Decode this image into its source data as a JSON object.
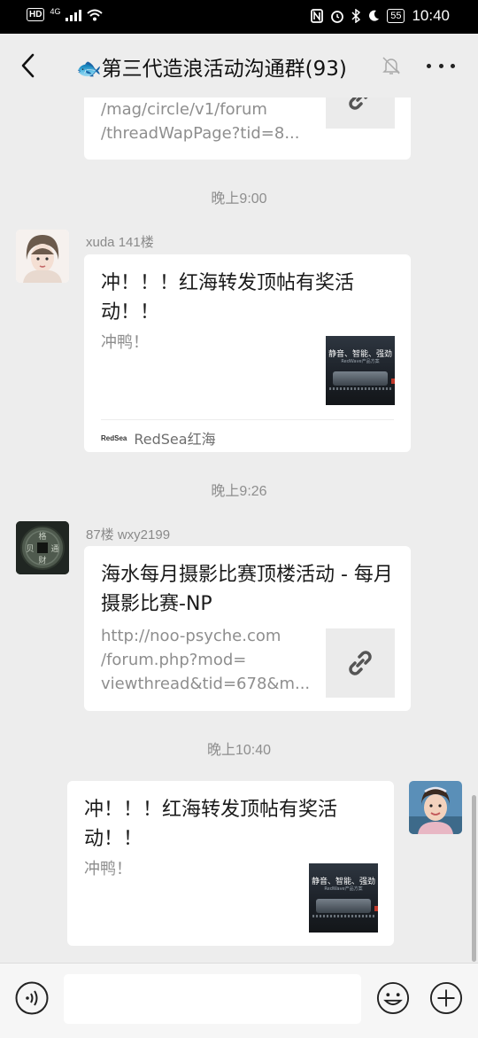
{
  "status_bar": {
    "hd": "HD",
    "network": "4G",
    "battery": "55",
    "time": "10:40"
  },
  "header": {
    "title": "🐟第三代造浪活动沟通群(93)"
  },
  "chat": {
    "partial_card": {
      "url": "/mag/circle/v1/forum\n/threadWapPage?tid=8..."
    },
    "timestamps": [
      "晚上9:00",
      "晚上9:26",
      "晚上10:40"
    ],
    "messages": [
      {
        "sender": "xuda 141楼",
        "title": "冲！！！红海转发顶帖有奖活动！！",
        "description": "冲鸭！",
        "thumb_text": "静音、智能、强劲",
        "thumb_sub": "RedWave产品方案",
        "source_logo": "RedSea",
        "source": "RedSea红海"
      },
      {
        "sender": "87楼 wxy2199",
        "title": "海水每月摄影比赛顶楼活动 - 每月摄影比赛-NP",
        "url": "http://noo-psyche.com\n/forum.php?mod=\nviewthread&tid=678&m..."
      },
      {
        "title": "冲！！！红海转发顶帖有奖活动！！",
        "description": "冲鸭！",
        "thumb_text": "静音、智能、强劲",
        "thumb_sub": "RedWave产品方案"
      }
    ]
  },
  "input_bar": {
    "placeholder": ""
  },
  "colors": {
    "background": "#ededed",
    "bubble": "#ffffff",
    "meta_text": "#8e8e8e"
  }
}
